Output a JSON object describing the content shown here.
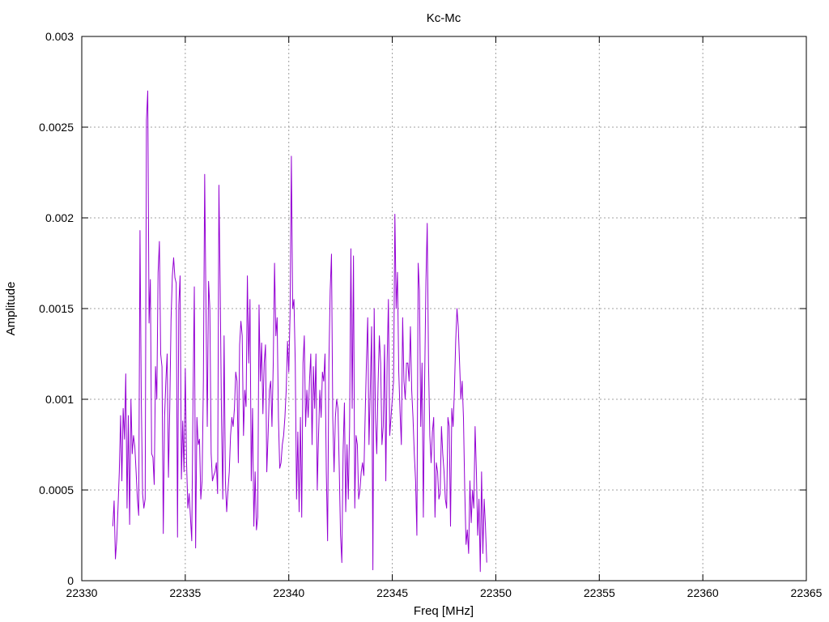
{
  "chart_data": {
    "type": "line",
    "title": "Kc-Mc",
    "xlabel": "Freq [MHz]",
    "ylabel": "Amplitude",
    "xlim": [
      22330,
      22365
    ],
    "ylim": [
      0,
      0.003
    ],
    "x_ticks": [
      "22330",
      "22335",
      "22340",
      "22345",
      "22350",
      "22355",
      "22360",
      "22365"
    ],
    "y_ticks": [
      "0",
      "0.0005",
      "0.001",
      "0.0015",
      "0.002",
      "0.0025",
      "0.003"
    ],
    "grid": true,
    "series": [
      {
        "color": "#9400d3",
        "x_start": 22331.5,
        "x_step": 0.0625,
        "values": [
          0.0003,
          0.00044,
          0.00012,
          0.00022,
          0.0004,
          0.0006,
          0.00091,
          0.00055,
          0.00095,
          0.00078,
          0.00114,
          0.0004,
          0.00091,
          0.00031,
          0.001,
          0.0007,
          0.0008,
          0.00074,
          0.0006,
          0.00045,
          0.00036,
          0.00193,
          0.001,
          0.00048,
          0.0004,
          0.00045,
          0.00254,
          0.0027,
          0.00142,
          0.00166,
          0.0007,
          0.00068,
          0.00053,
          0.00118,
          0.001,
          0.0017,
          0.00187,
          0.00125,
          0.00118,
          0.00026,
          0.0009,
          0.0011,
          0.00125,
          0.00057,
          0.00095,
          0.00144,
          0.00168,
          0.00178,
          0.00167,
          0.00164,
          0.00024,
          0.00152,
          0.00168,
          0.00056,
          0.00088,
          0.0006,
          0.00117,
          0.00065,
          0.0004,
          0.00048,
          0.00035,
          0.00022,
          0.00101,
          0.00162,
          0.00018,
          0.0009,
          0.00075,
          0.00078,
          0.00045,
          0.00055,
          0.0011,
          0.00224,
          0.0015,
          0.00085,
          0.00165,
          0.0015,
          0.0007,
          0.00055,
          0.00058,
          0.0006,
          0.00065,
          0.00048,
          0.00218,
          0.0016,
          0.0009,
          0.00045,
          0.00135,
          0.00055,
          0.00038,
          0.0005,
          0.0006,
          0.0008,
          0.0009,
          0.00085,
          0.00095,
          0.00115,
          0.0011,
          0.00065,
          0.0013,
          0.00143,
          0.00135,
          0.0008,
          0.00105,
          0.00096,
          0.00168,
          0.0012,
          0.00155,
          0.00055,
          0.00095,
          0.0003,
          0.0006,
          0.00028,
          0.00035,
          0.00152,
          0.0011,
          0.00131,
          0.00092,
          0.0012,
          0.0013,
          0.0006,
          0.0008,
          0.00105,
          0.0011,
          0.00085,
          0.0012,
          0.00175,
          0.00135,
          0.00145,
          0.0009,
          0.00062,
          0.00065,
          0.00075,
          0.0008,
          0.0009,
          0.00105,
          0.00132,
          0.00115,
          0.00147,
          0.00234,
          0.0015,
          0.00155,
          0.0012,
          0.00045,
          0.00082,
          0.00038,
          0.0009,
          0.00035,
          0.0012,
          0.00135,
          0.00085,
          0.00105,
          0.0009,
          0.0011,
          0.00125,
          0.00075,
          0.00118,
          0.00095,
          0.00125,
          0.0005,
          0.0008,
          0.00105,
          0.0009,
          0.00115,
          0.0011,
          0.00125,
          0.0006,
          0.00022,
          0.0012,
          0.0016,
          0.0018,
          0.0009,
          0.0006,
          0.0009,
          0.001,
          0.00095,
          0.00062,
          0.00025,
          0.0001,
          0.00072,
          0.00098,
          0.00038,
          0.00075,
          0.00045,
          0.00085,
          0.00183,
          0.00095,
          0.00179,
          0.0004,
          0.0008,
          0.00075,
          0.00045,
          0.0005,
          0.0006,
          0.00065,
          0.00058,
          0.0009,
          0.0012,
          0.00145,
          0.00075,
          0.00105,
          0.0014,
          6e-05,
          0.0015,
          0.0009,
          0.0007,
          0.00108,
          0.00135,
          0.0012,
          0.00075,
          0.00085,
          0.0013,
          0.00055,
          0.0012,
          0.00155,
          0.0008,
          0.0009,
          0.001,
          0.0011,
          0.00202,
          0.0015,
          0.0017,
          0.00115,
          0.00093,
          0.00075,
          0.00145,
          0.0011,
          0.001,
          0.0012,
          0.0012,
          0.0011,
          0.0014,
          0.00105,
          0.0009,
          0.0007,
          0.00055,
          0.00025,
          0.00175,
          0.0016,
          0.00085,
          0.0012,
          0.00035,
          0.0011,
          0.00165,
          0.00197,
          0.0012,
          0.0008,
          0.00065,
          0.00082,
          0.0009,
          0.00035,
          0.00065,
          0.0006,
          0.00045,
          0.00048,
          0.00085,
          0.0007,
          0.0006,
          0.00045,
          0.0004,
          0.0009,
          0.00085,
          0.0003,
          0.00095,
          0.00085,
          0.00105,
          0.00132,
          0.0015,
          0.0014,
          0.0012,
          0.001,
          0.0011,
          0.0009,
          0.0005,
          0.0002,
          0.00028,
          0.00015,
          0.00055,
          0.00032,
          0.0005,
          0.0004,
          0.00085,
          0.0006,
          0.00025,
          0.00045,
          5e-05,
          0.0006,
          0.00015,
          0.00045,
          0.0003,
          0.0001
        ]
      }
    ]
  }
}
